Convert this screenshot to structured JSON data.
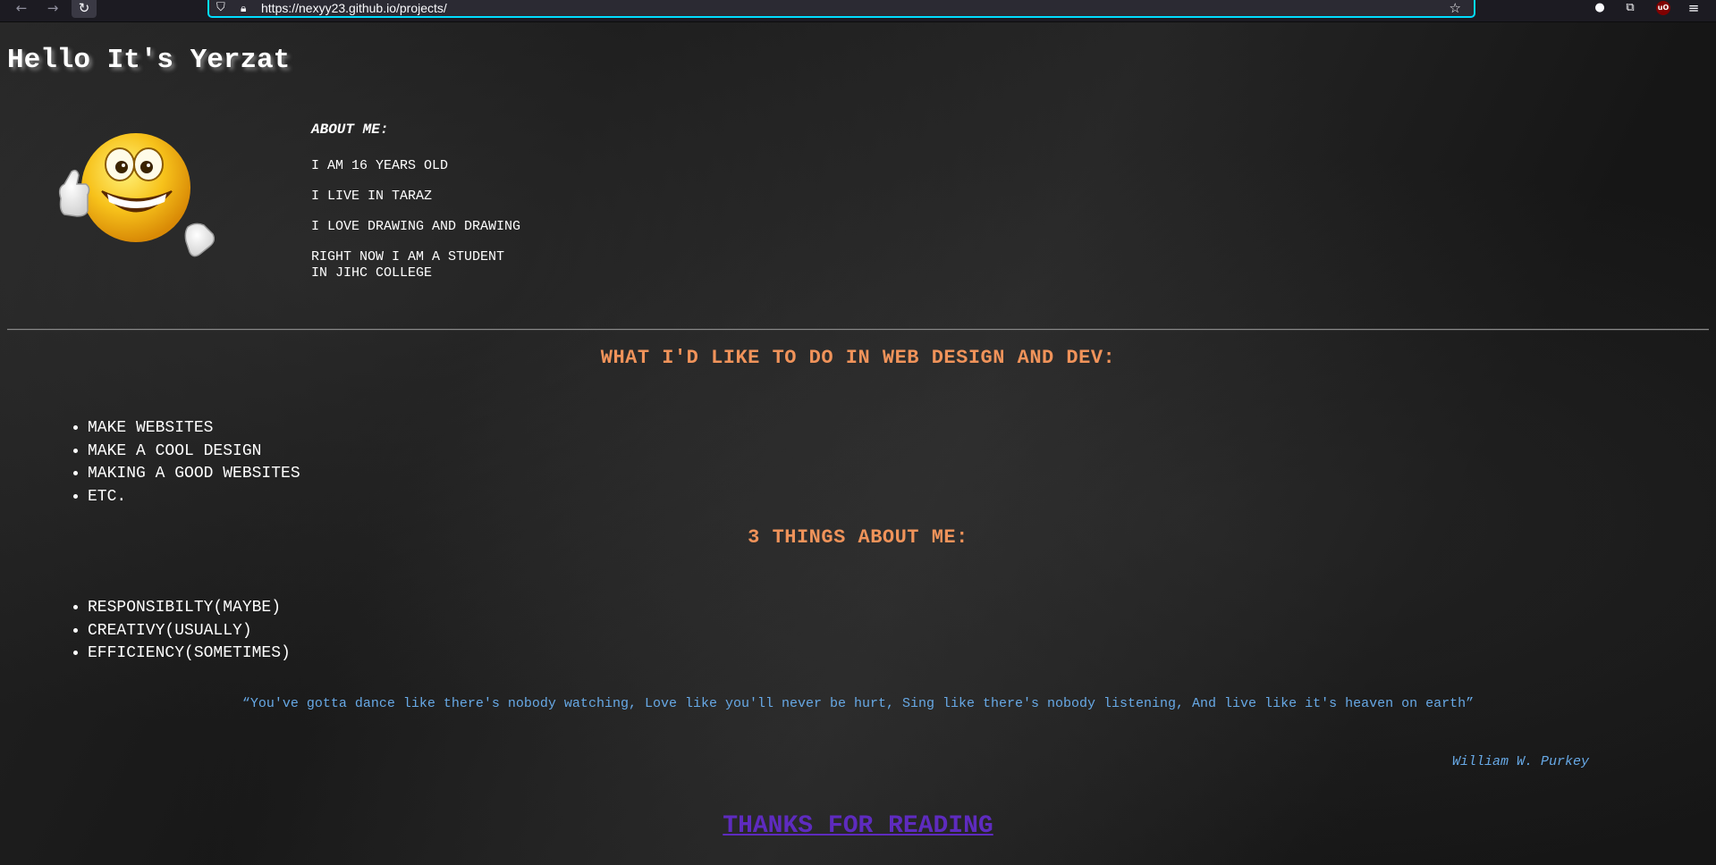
{
  "browser": {
    "back_icon": "arrow-left-icon",
    "forward_icon": "arrow-right-icon",
    "reload_icon": "reload-icon",
    "url": "https://nexyy23.github.io/projects/",
    "accent_color": "#00ddff"
  },
  "page": {
    "title": "Hello It's Yerzat",
    "smiley_icon": "smiley-thumbs-up-icon",
    "about": {
      "heading": "ABOUT ME:",
      "facts": [
        "I AM 16 YEARS OLD",
        "I LIVE IN TARAZ",
        "I LOVE DRAWING AND DRAWING",
        "RIGHT NOW I AM A STUDENT",
        "IN JIHC COLLEGE"
      ]
    },
    "goals": {
      "heading": "WHAT I'D LIKE TO DO IN WEB DESIGN AND DEV:",
      "items": [
        "MAKE WEBSITES",
        "MAKE A COOL DESIGN",
        "MAKING A GOOD WEBSITES",
        "ETC."
      ]
    },
    "things": {
      "heading": "3 THINGS ABOUT ME:",
      "items": [
        "RESPONSIBILTY(MAYBE)",
        "CREATIVY(USUALLY)",
        "EFFICIENCY(SOMETIMES)"
      ]
    },
    "quote": "“You've gotta dance like there's nobody watching, Love like you'll never be hurt, Sing like there's nobody listening, And live like it's heaven on earth”",
    "quote_author": "William W. Purkey",
    "thanks_link": "THANKS FOR READING",
    "colors": {
      "heading": "#f0935a",
      "quote": "#67a9e6",
      "link": "#5e2bbf"
    }
  }
}
